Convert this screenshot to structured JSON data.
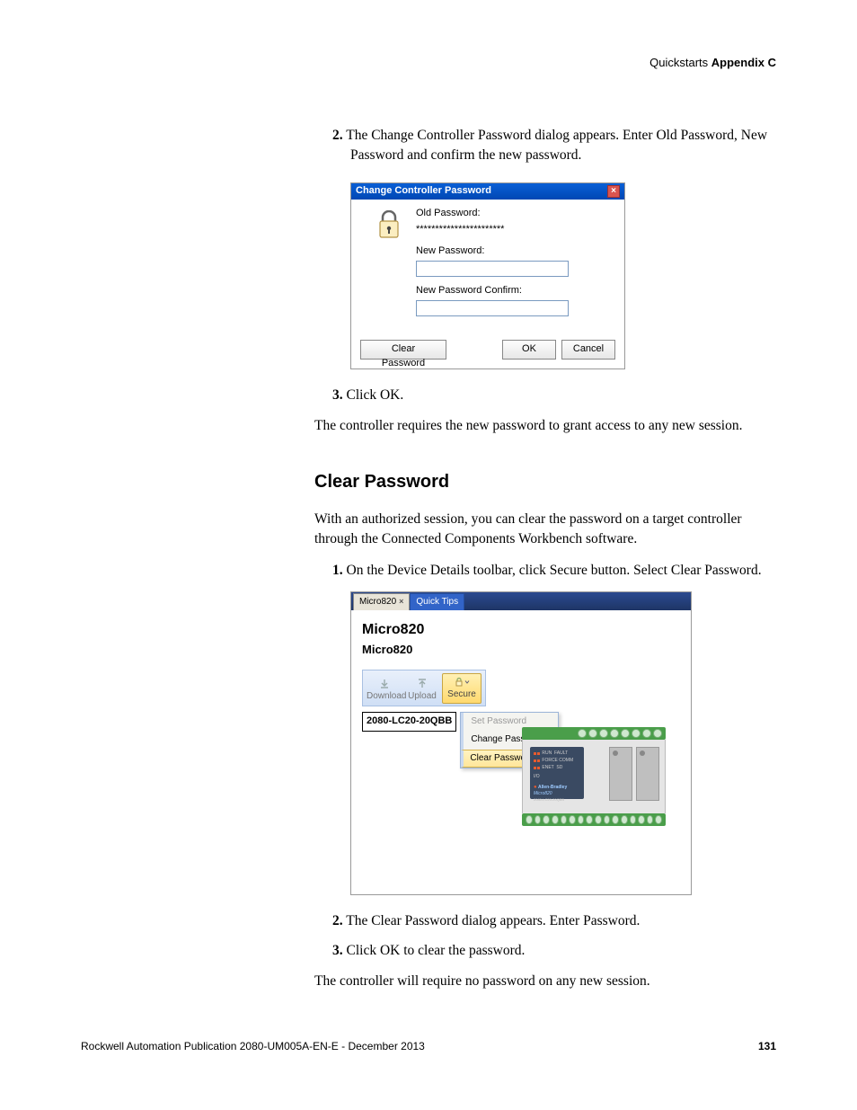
{
  "header": {
    "section": "Quickstarts",
    "appendix": "Appendix C"
  },
  "steps_a": {
    "2": {
      "num": "2.",
      "text": "The Change Controller Password dialog appears. Enter Old Password, New Password and confirm the new password."
    },
    "3": {
      "num": "3.",
      "text": "Click OK."
    }
  },
  "dialog1": {
    "title": "Change Controller Password",
    "old_label": "Old Password:",
    "old_value": "***********************",
    "new_label": "New Password:",
    "confirm_label": "New Password Confirm:",
    "btn_clear": "Clear Password",
    "btn_ok": "OK",
    "btn_cancel": "Cancel"
  },
  "para_after_step3": "The controller requires the new password to grant access to any new session.",
  "h2_clear": "Clear Password",
  "para_clear_intro": "With an authorized session, you can clear the password on a target controller through the Connected Components Workbench software.",
  "steps_b": {
    "1": {
      "num": "1.",
      "text": "On the Device Details toolbar, click Secure button. Select Clear Password."
    },
    "2": {
      "num": "2.",
      "text": "The Clear Password dialog appears. Enter Password."
    },
    "3": {
      "num": "3.",
      "text": "Click OK to clear the password."
    }
  },
  "screenshot2": {
    "tab1": "Micro820",
    "tab2": "Quick Tips",
    "title1": "Micro820",
    "title2": "Micro820",
    "tb_download": "Download",
    "tb_upload": "Upload",
    "tb_secure": "Secure",
    "partnum": "2080-LC20-20QBB",
    "menu_set": "Set Password",
    "menu_change": "Change Password",
    "menu_clear": "Clear Password",
    "device_ab": "Allen-Bradley",
    "device_model": "Micro820",
    "device_cat": "2080-LC20-20QBB"
  },
  "para_final": "The controller will require no password on any new session.",
  "footer": {
    "pub": "Rockwell Automation Publication 2080-UM005A-EN-E - December 2013",
    "page": "131"
  }
}
